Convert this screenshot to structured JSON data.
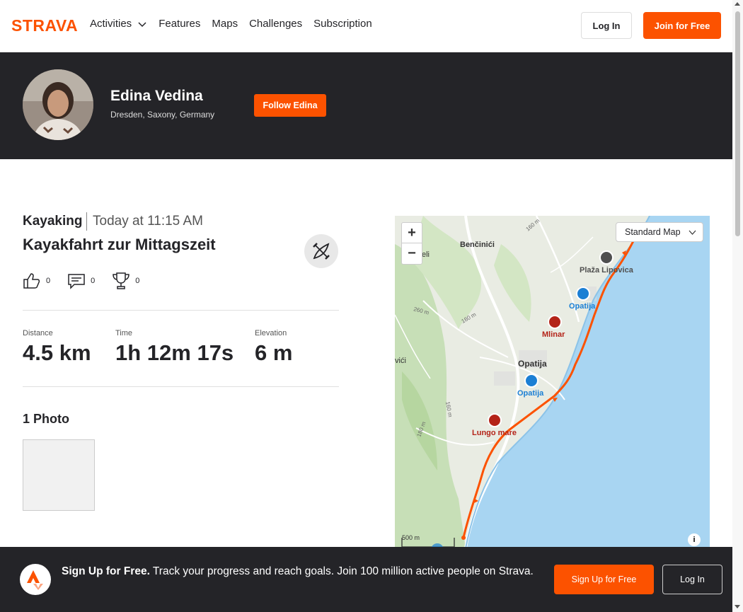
{
  "nav": {
    "logo_text": "STRAVA",
    "links": [
      "Activities",
      "Features",
      "Maps",
      "Challenges",
      "Subscription"
    ],
    "login_label": "Log In",
    "join_label": "Join for Free"
  },
  "athlete": {
    "name": "Edina Vedina",
    "location": "Dresden, Saxony, Germany",
    "follow_label": "Follow Edina"
  },
  "activity": {
    "type": "Kayaking",
    "time": "Today at 11:15 AM",
    "title": "Kayakfahrt zur Mittagszeit",
    "sport_icon": "kayak-icon",
    "kudos": "0",
    "comments": "0",
    "achievements": "0",
    "stats": {
      "distance_label": "Distance",
      "distance_value": "4.5 km",
      "time_label": "Time",
      "time_value": "1h 12m 17s",
      "elevation_label": "Elevation",
      "elevation_value": "6 m"
    },
    "photos_title": "1 Photo"
  },
  "map": {
    "zoom_in": "+",
    "zoom_out": "−",
    "map_type": "Standard Map",
    "places": {
      "bencinici": "Benčinići",
      "eli": "eli",
      "vici": "vići",
      "opatija_town": "Opatija"
    },
    "pois": {
      "plaza": "Plaža Lipovica",
      "opatija1": "Opatija",
      "mlinar": "Mlinar",
      "opatija2": "Opatija",
      "lungo": "Lungo mare"
    },
    "contours": [
      "160 m",
      "260 m",
      "180 m",
      "160 m",
      "180 m"
    ],
    "scale": "500 m",
    "info": "i",
    "route_color": "#fc5200"
  },
  "signup": {
    "headline": "Sign Up for Free.",
    "body": " Track your progress and reach goals. Join 100 million active people on Strava.",
    "signup_label": "Sign Up for Free",
    "login_label": "Log In"
  },
  "colors": {
    "brand": "#fc5200",
    "dark": "#242428"
  }
}
